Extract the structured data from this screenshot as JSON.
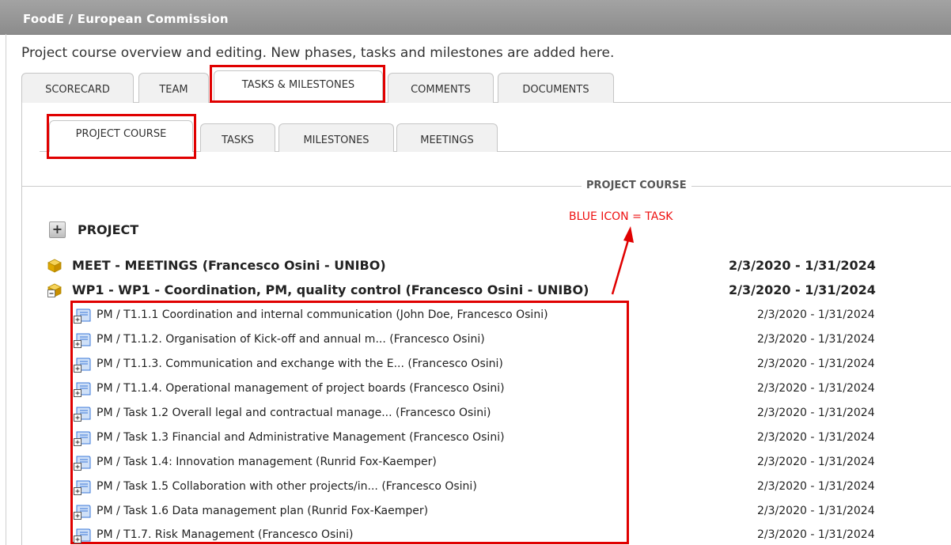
{
  "header": {
    "title": "FoodE / European Commission"
  },
  "description": "Project course overview and editing. New phases, tasks and milestones are added here.",
  "main_tabs": [
    "SCORECARD",
    "TEAM",
    "TASKS & MILESTONES",
    "COMMENTS",
    "DOCUMENTS"
  ],
  "sub_tabs": [
    "PROJECT COURSE",
    "TASKS",
    "MILESTONES",
    "MEETINGS"
  ],
  "section": {
    "title": "PROJECT COURSE"
  },
  "annotation": {
    "label": "BLUE ICON = TASK"
  },
  "project": {
    "label": "PROJECT"
  },
  "phases": [
    {
      "name": "MEET - MEETINGS (Francesco Osini - UNIBO)",
      "dates": "2/3/2020 - 1/31/2024"
    },
    {
      "name": "WP1 - WP1 - Coordination, PM, quality control (Francesco Osini - UNIBO)",
      "dates": "2/3/2020 - 1/31/2024"
    }
  ],
  "tasks": [
    {
      "name": "PM / T1.1.1 Coordination and internal communication (John Doe, Francesco Osini)",
      "dates": "2/3/2020 - 1/31/2024"
    },
    {
      "name": "PM / T1.1.2. Organisation of Kick-off and annual m... (Francesco Osini)",
      "dates": "2/3/2020 - 1/31/2024"
    },
    {
      "name": "PM / T1.1.3. Communication and exchange with the E... (Francesco Osini)",
      "dates": "2/3/2020 - 1/31/2024"
    },
    {
      "name": "PM / T1.1.4. Operational management of project boards (Francesco Osini)",
      "dates": "2/3/2020 - 1/31/2024"
    },
    {
      "name": "PM / Task 1.2 Overall legal and contractual manage... (Francesco Osini)",
      "dates": "2/3/2020 - 1/31/2024"
    },
    {
      "name": "PM / Task 1.3 Financial and Administrative Management (Francesco Osini)",
      "dates": "2/3/2020 - 1/31/2024"
    },
    {
      "name": "PM / Task 1.4: Innovation management (Runrid Fox-Kaemper)",
      "dates": "2/3/2020 - 1/31/2024"
    },
    {
      "name": "PM / Task 1.5 Collaboration with other projects/in... (Francesco Osini)",
      "dates": "2/3/2020 - 1/31/2024"
    },
    {
      "name": "PM / Task 1.6 Data management plan (Runrid Fox-Kaemper)",
      "dates": "2/3/2020 - 1/31/2024"
    },
    {
      "name": "PM / T1.7. Risk Management (Francesco Osini)",
      "dates": "2/3/2020 - 1/31/2024"
    }
  ],
  "colors": {
    "header": "#989898",
    "annotation": "#e00000",
    "task_icon": "#3b78d8",
    "phase_icon": "#e6b800"
  }
}
